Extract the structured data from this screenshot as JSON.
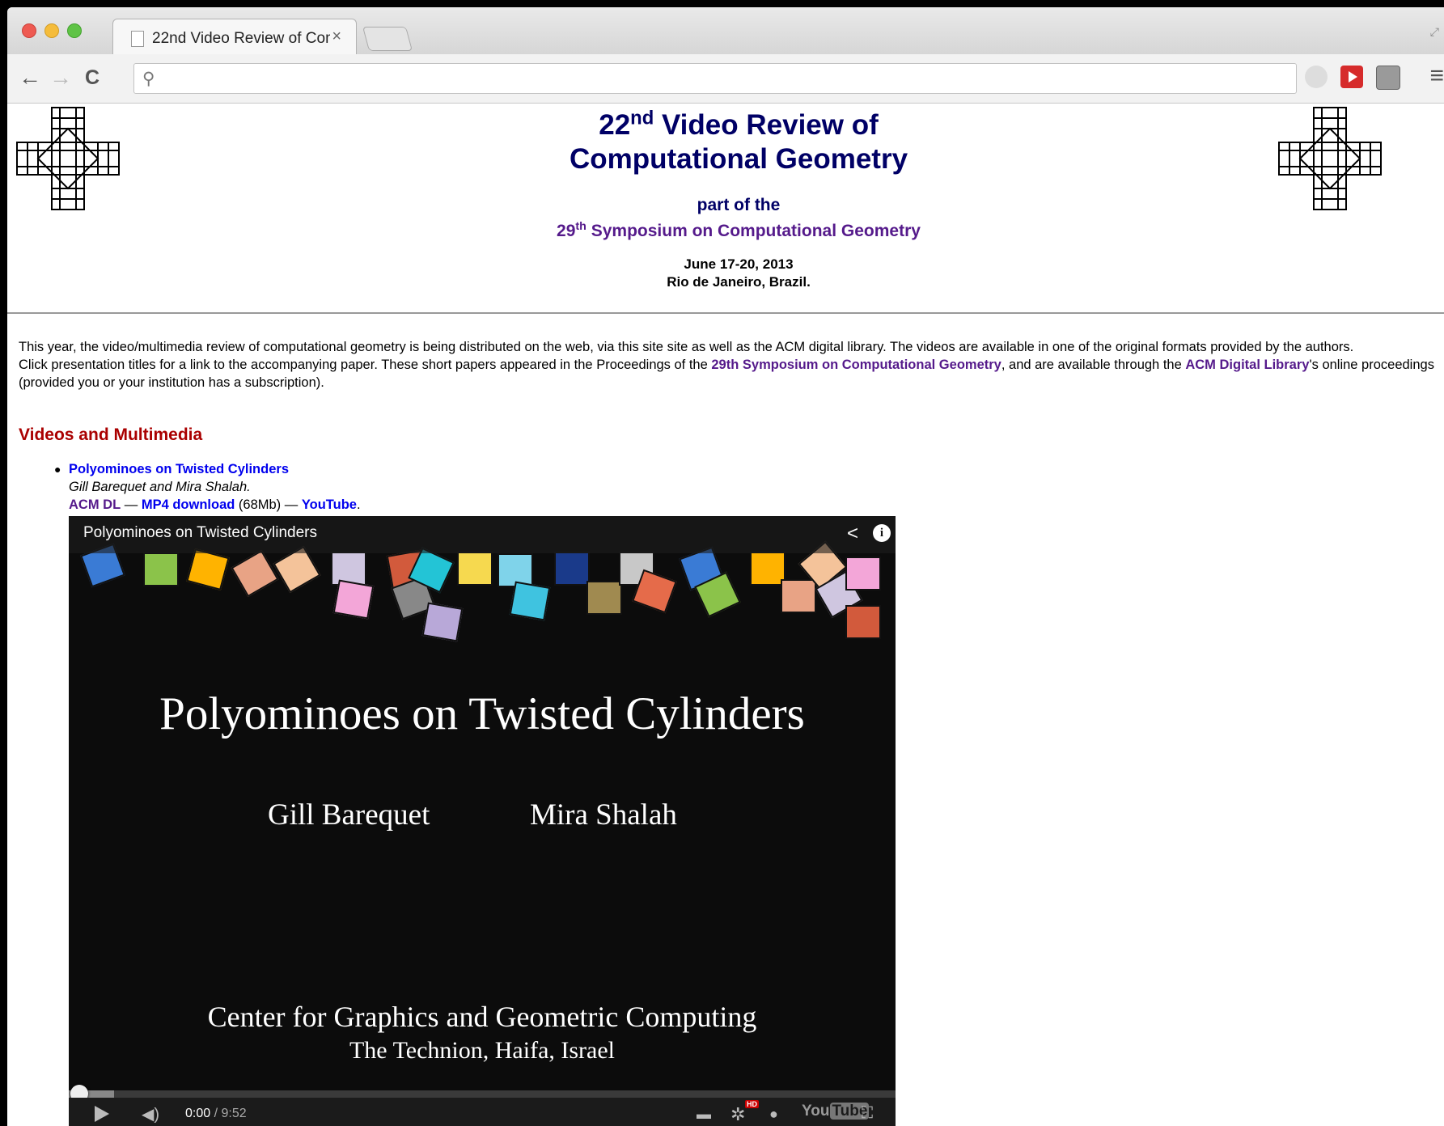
{
  "browser": {
    "tab_title": "22nd Video Review of Com",
    "tab_close": "×",
    "address": "",
    "back": "←",
    "forward": "→",
    "reload": "C",
    "menu": "≡"
  },
  "page": {
    "title_prefix": "22",
    "title_sup": "nd",
    "title_rest": " Video Review of",
    "title_line2": "Computational Geometry",
    "part_of": "part of the",
    "symp_num": "29",
    "symp_sup": "th",
    "symp_name": " Symposium on Computational Geometry",
    "date": "June 17-20, 2013",
    "location": "Rio de Janeiro, Brazil.",
    "intro_1": "This year, the video/multimedia review of computational geometry is being distributed on the web, via this site site as well as the ACM digital library. The videos are available in one of the original formats provided by the authors.",
    "intro_2a": "Click presentation titles for a link to the accompanying paper. These short papers appeared in the Proceedings of the ",
    "intro_2_link1": "29th Symposium on Computational Geometry",
    "intro_2b": ", and are available through the ",
    "intro_2_link2": "ACM Digital Library",
    "intro_2c": "'s online proceedings (provided you or your institution has a subscription).",
    "section_heading": "Videos and Multimedia"
  },
  "videos": [
    {
      "title": "Polyominoes on Twisted Cylinders",
      "authors": "Gill Barequet and Mira Shalah.",
      "acm_dl": "ACM DL",
      "sep1": " — ",
      "mp4": "MP4 download",
      "size": " (68Mb) — ",
      "youtube": "YouTube",
      "end": "."
    }
  ],
  "player": {
    "overlay_title": "Polyominoes on Twisted Cylinders",
    "slide_title": "Polyominoes on Twisted Cylinders",
    "author1": "Gill Barequet",
    "author2": "Mira Shalah",
    "center": "Center for Graphics and Geometric Computing",
    "place": "The Technion, Haifa, Israel",
    "time_current": "0:00",
    "time_sep": " / ",
    "time_total": "9:52",
    "hd_badge": "HD",
    "youtube_logo_a": "You",
    "youtube_logo_b": "Tube",
    "progress_fraction": 0.0
  },
  "colors": {
    "heading_navy": "#000066",
    "visited_link": "#551a8b",
    "link": "#0000ee",
    "section_red": "#aa0000"
  }
}
